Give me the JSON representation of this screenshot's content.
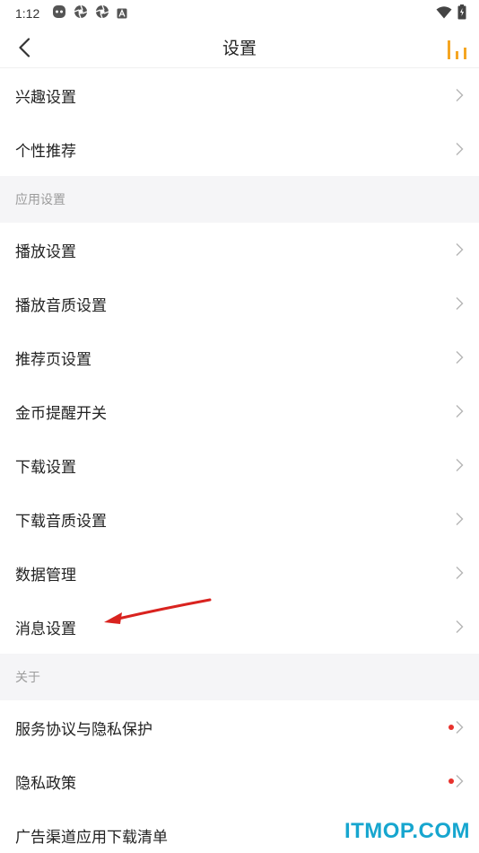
{
  "status_bar": {
    "time": "1:12"
  },
  "nav": {
    "title": "设置"
  },
  "group1": {
    "items": [
      {
        "label": "兴趣设置"
      },
      {
        "label": "个性推荐"
      }
    ]
  },
  "section_app": {
    "title": "应用设置"
  },
  "group2": {
    "items": [
      {
        "label": "播放设置"
      },
      {
        "label": "播放音质设置"
      },
      {
        "label": "推荐页设置"
      },
      {
        "label": "金币提醒开关"
      },
      {
        "label": "下载设置"
      },
      {
        "label": "下载音质设置"
      },
      {
        "label": "数据管理"
      },
      {
        "label": "消息设置"
      }
    ]
  },
  "section_about": {
    "title": "关于"
  },
  "group3": {
    "items": [
      {
        "label": "服务协议与隐私保护",
        "badge": "red-dot"
      },
      {
        "label": "隐私政策",
        "badge": "red-dot"
      },
      {
        "label": "广告渠道应用下载清单"
      }
    ]
  },
  "watermark": "ITMOP.COM",
  "colors": {
    "accent": "#f5a623",
    "red_dot": "#e8322d",
    "section_bg": "#f5f5f7",
    "arrow": "#d9231f",
    "watermark": "#17a6cf"
  }
}
